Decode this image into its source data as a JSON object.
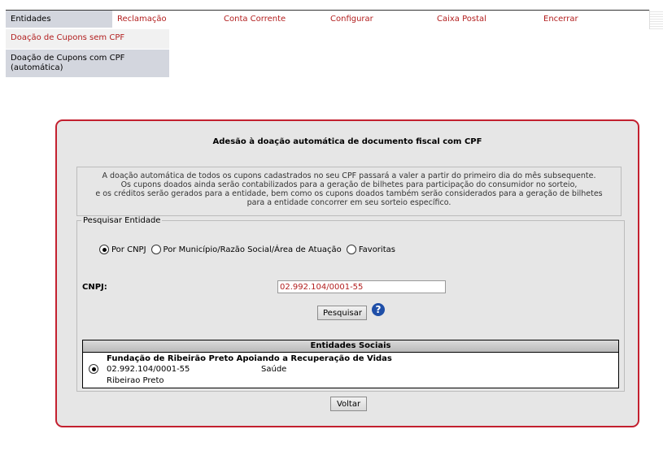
{
  "topnav": {
    "tabs": [
      {
        "label": "Entidades",
        "active": true
      },
      {
        "label": "Reclamação",
        "active": false
      },
      {
        "label": "Conta Corrente",
        "active": false
      },
      {
        "label": "Configurar",
        "active": false
      },
      {
        "label": "Caixa Postal",
        "active": false
      },
      {
        "label": "Encerrar",
        "active": false
      }
    ]
  },
  "submenu": {
    "item1": "Doação de Cupons sem CPF",
    "item2_line1": "Doação de Cupons com CPF",
    "item2_line2": "(automática)"
  },
  "panel": {
    "title": "Adesão à doação automática de documento fiscal com CPF",
    "info_lines": [
      "A doação automática de todos os cupons cadastrados no seu CPF passará a valer a partir do primeiro dia do mês subsequente.",
      "Os cupons doados ainda serão contabilizados para a geração de bilhetes para participação do consumidor no sorteio,",
      "e os créditos serão gerados para a entidade, bem como os cupons doados também serão considerados para a geração de bilhetes",
      "para a entidade concorrer em seu sorteio específico."
    ],
    "search": {
      "legend": "Pesquisar Entidade",
      "options": [
        {
          "label": "Por CNPJ",
          "selected": true
        },
        {
          "label": "Por Município/Razão Social/Área de Atuação",
          "selected": false
        },
        {
          "label": "Favoritas",
          "selected": false
        }
      ],
      "cnpj_label": "CNPJ:",
      "cnpj_value": "02.992.104/0001-55",
      "search_button": "Pesquisar",
      "help_glyph": "?"
    },
    "entities": {
      "header": "Entidades Sociais",
      "rows": [
        {
          "name": "Fundação de Ribeirão Preto Apoiando a Recuperação de Vidas",
          "cnpj": "02.992.104/0001-55",
          "area": "Saúde",
          "city": "Ribeirao Preto",
          "selected": true
        }
      ]
    },
    "back_button": "Voltar"
  },
  "colors": {
    "accent_red": "#b21e1e",
    "panel_border": "#c3202f",
    "help_blue": "#1f4fa8"
  }
}
